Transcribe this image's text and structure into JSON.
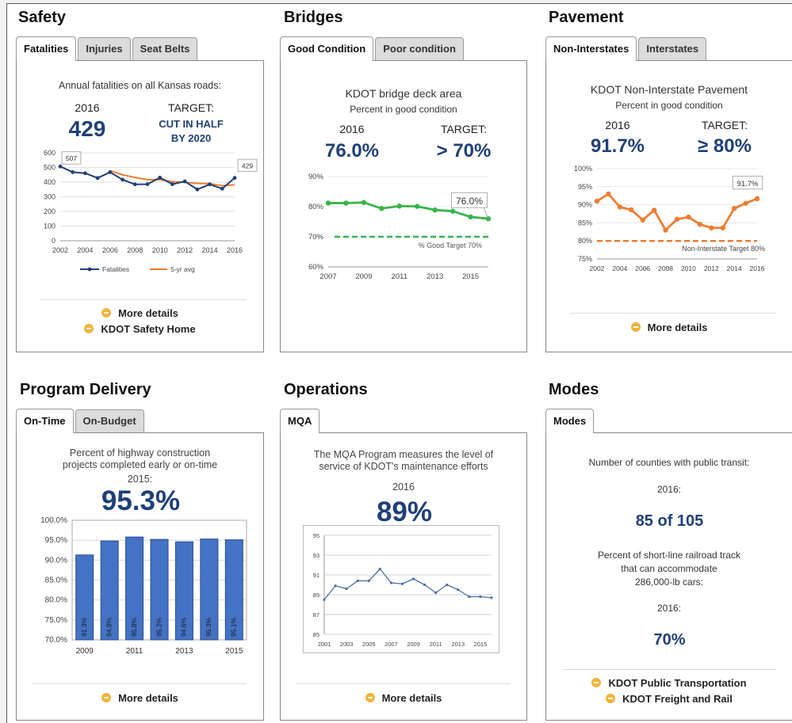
{
  "safety": {
    "title": "Safety",
    "tabs": [
      "Fatalities",
      "Injuries",
      "Seat Belts"
    ],
    "chart_title": "Annual fatalities on all Kansas roads:",
    "year_label": "2016",
    "value": "429",
    "target_label": "TARGET:",
    "target_line1": "CUT IN HALF",
    "target_line2": "BY 2020",
    "links": [
      "More details",
      "KDOT Safety Home"
    ]
  },
  "bridges": {
    "title": "Bridges",
    "tabs": [
      "Good Condition",
      "Poor condition"
    ],
    "chart_title": "KDOT bridge deck area",
    "chart_subtitle": "Percent in good condition",
    "year_label": "2016",
    "value": "76.0%",
    "target_label": "TARGET:",
    "target_value": "> 70%"
  },
  "pavement": {
    "title": "Pavement",
    "tabs": [
      "Non-Interstates",
      "Interstates"
    ],
    "chart_title": "KDOT Non-Interstate Pavement",
    "chart_subtitle": "Percent in good condition",
    "year_label": "2016",
    "value": "91.7%",
    "target_label": "TARGET:",
    "target_value": "≥ 80%",
    "links": [
      "More details"
    ]
  },
  "program": {
    "title": "Program Delivery",
    "tabs": [
      "On-Time",
      "On-Budget"
    ],
    "chart_title_1": "Percent of highway construction",
    "chart_title_2": "projects completed early or on-time",
    "year_label": "2015:",
    "value": "95.3%",
    "links": [
      "More details"
    ]
  },
  "operations": {
    "title": "Operations",
    "tabs": [
      "MQA"
    ],
    "chart_title_1": "The MQA Program measures the level of",
    "chart_title_2": "service of KDOT's maintenance efforts",
    "year_label": "2016",
    "value": "89%",
    "links": [
      "More details"
    ]
  },
  "modes": {
    "title": "Modes",
    "tabs": [
      "Modes"
    ],
    "q1": "Number of counties with public transit:",
    "y1": "2016:",
    "v1": "85 of 105",
    "q2_line1": "Percent of short-line railroad track",
    "q2_line2": "that can accommodate",
    "q2_line3": "286,000-lb cars:",
    "y2": "2016:",
    "v2": "70%",
    "links": [
      "KDOT Public Transportation",
      "KDOT Freight and Rail"
    ]
  },
  "chart_data": [
    {
      "id": "safety",
      "type": "line",
      "x": [
        2002,
        2003,
        2004,
        2005,
        2006,
        2007,
        2008,
        2009,
        2010,
        2011,
        2012,
        2013,
        2014,
        2015,
        2016
      ],
      "series": [
        {
          "name": "Fatalities",
          "values": [
            507,
            468,
            461,
            428,
            468,
            417,
            385,
            386,
            431,
            386,
            405,
            350,
            385,
            355,
            429
          ],
          "color": "#1f3f78"
        },
        {
          "name": "5-yr avg",
          "values": [
            null,
            null,
            null,
            null,
            478,
            450,
            432,
            417,
            417,
            403,
            399,
            392,
            389,
            376,
            382
          ],
          "color": "#ed7d31"
        }
      ],
      "ylim": [
        0,
        600
      ],
      "yticks": [
        0,
        100,
        200,
        300,
        400,
        500,
        600
      ],
      "xticks": [
        2002,
        2004,
        2006,
        2008,
        2010,
        2012,
        2014,
        2016
      ],
      "annotations": [
        "507",
        "429"
      ],
      "legend": "bottom"
    },
    {
      "id": "bridges",
      "type": "line",
      "x": [
        2007,
        2008,
        2009,
        2010,
        2011,
        2012,
        2013,
        2014,
        2015,
        2016
      ],
      "series": [
        {
          "values": [
            81.2,
            81.2,
            81.4,
            79.4,
            80.2,
            80.1,
            78.9,
            78.5,
            76.6,
            76.0
          ],
          "color": "#38b44a"
        }
      ],
      "target": {
        "value": 70,
        "label": "% Good Target 70%",
        "color": "#38b44a"
      },
      "ylim": [
        60,
        90
      ],
      "yticks": [
        "60%",
        "70%",
        "80%",
        "90%"
      ],
      "xticks": [
        2007,
        2009,
        2011,
        2013,
        2015
      ],
      "annotations": [
        "76.0%"
      ]
    },
    {
      "id": "pavement",
      "type": "line",
      "x": [
        2002,
        2003,
        2004,
        2005,
        2006,
        2007,
        2008,
        2009,
        2010,
        2011,
        2012,
        2013,
        2014,
        2015,
        2016
      ],
      "series": [
        {
          "values": [
            91.0,
            93.0,
            89.4,
            88.6,
            85.8,
            88.5,
            83.0,
            86.0,
            86.6,
            84.6,
            83.6,
            83.6,
            89.0,
            90.4,
            91.7
          ],
          "color": "#ed7d31"
        }
      ],
      "target": {
        "value": 80,
        "label": "Non-Interstate Target 80%",
        "color": "#ed7d31"
      },
      "ylim": [
        75,
        100
      ],
      "yticks": [
        "75%",
        "80%",
        "85%",
        "90%",
        "95%",
        "100%"
      ],
      "xticks": [
        2002,
        2004,
        2006,
        2008,
        2010,
        2012,
        2014,
        2016
      ],
      "annotations": [
        "91.7%"
      ]
    },
    {
      "id": "program",
      "type": "bar",
      "categories": [
        "2009",
        "2010",
        "2011",
        "2012",
        "2013",
        "2014",
        "2015"
      ],
      "values": [
        91.3,
        94.8,
        95.8,
        95.2,
        94.6,
        95.3,
        95.1
      ],
      "data_labels": [
        "91.3%",
        "94.8%",
        "95.8%",
        "95.2%",
        "94.6%",
        "95.3%",
        "95.1%"
      ],
      "ylim": [
        70,
        100
      ],
      "yticks": [
        "70.0%",
        "75.0%",
        "80.0%",
        "85.0%",
        "90.0%",
        "95.0%",
        "100.0%"
      ],
      "xticks": [
        "2009",
        "2011",
        "2013",
        "2015"
      ],
      "color": "#4472c4"
    },
    {
      "id": "operations",
      "type": "line",
      "x": [
        2001,
        2002,
        2003,
        2004,
        2005,
        2006,
        2007,
        2008,
        2009,
        2010,
        2011,
        2012,
        2013,
        2014,
        2015,
        2016
      ],
      "series": [
        {
          "values": [
            88.5,
            89.9,
            89.6,
            90.4,
            90.4,
            91.6,
            90.2,
            90.1,
            90.6,
            90.0,
            89.2,
            90.0,
            89.5,
            88.8,
            88.8,
            88.7
          ],
          "color": "#4a6fa5"
        }
      ],
      "ylim": [
        85,
        95
      ],
      "yticks": [
        85,
        87,
        89,
        91,
        93,
        95
      ],
      "xticks": [
        2001,
        2003,
        2005,
        2007,
        2009,
        2011,
        2013,
        2015
      ]
    }
  ]
}
